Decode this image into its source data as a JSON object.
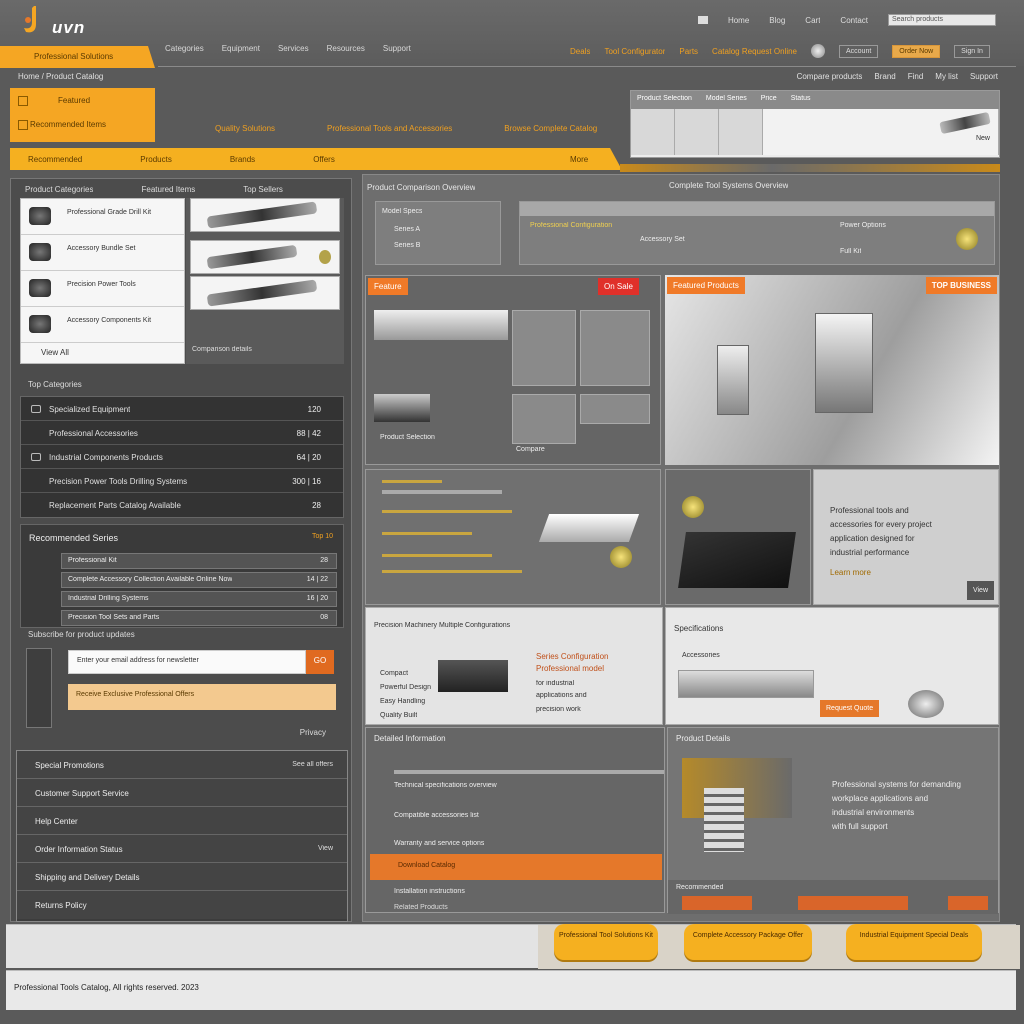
{
  "logo": {
    "word": "uvn"
  },
  "topnav": {
    "items": [
      "Home",
      "Blog",
      "Cart",
      "Contact"
    ],
    "search_placeholder": "Search products"
  },
  "brand_tab": {
    "label": "Professional Solutions"
  },
  "mainnav": {
    "items": [
      "Categories",
      "Equipment",
      "Services",
      "Resources",
      "Support"
    ]
  },
  "rightnav": {
    "items": [
      "Deals",
      "Tool Configurator",
      "Parts",
      "Catalog Request Online"
    ],
    "pill1": "Account",
    "pill2": "Order Now",
    "pill3": "Sign In"
  },
  "crumbs": {
    "left": "Home / Product Catalog",
    "right": [
      "Compare products",
      "Brand",
      "Find",
      "My list",
      "Support"
    ]
  },
  "hero": {
    "left_line1": "Featured",
    "left_line2": "Recommended Items",
    "mid": [
      "Quality Solutions",
      "Professional Tools and Accessories",
      "Browse Complete Catalog"
    ],
    "table_head": [
      "Product Selection",
      "Model Series",
      "Price",
      "Status"
    ],
    "table_tool_label": "New"
  },
  "orange_bar": {
    "items": [
      "Recommended",
      "Products",
      "Brands",
      "Offers"
    ],
    "right": "More"
  },
  "left": {
    "head": [
      "Product Categories",
      "Featured Items",
      "Top Sellers"
    ],
    "products": [
      {
        "name": "Professional Grade Drill Kit"
      },
      {
        "name": "Accessory Bundle Set"
      },
      {
        "name": "Precision Power Tools"
      },
      {
        "name": "Accessory Components Kit"
      }
    ],
    "products_foot": "View All",
    "img_label": "Comparison details",
    "list_title": "Top Categories",
    "menu1": [
      {
        "label": "Specialized Equipment",
        "val": "120"
      },
      {
        "label": "Professional Accessories",
        "val": "88 | 42"
      },
      {
        "label": "Industrial Components Products",
        "val": "64 | 20"
      },
      {
        "label": "Precision Power Tools Drilling Systems",
        "val": "300 | 16"
      },
      {
        "label": "Replacement Parts Catalog Available",
        "val": "28"
      }
    ],
    "menu2_head": "Recommended Series",
    "menu2_headr": "Top 10",
    "menu2_rows": [
      {
        "label": "Professional Kit",
        "val": "28"
      },
      {
        "label": "Complete Accessory Collection Available Online Now",
        "val": "14 | 22"
      },
      {
        "label": "Industrial Drilling Systems",
        "val": "16 | 20"
      },
      {
        "label": "Precision Tool Sets and Parts",
        "val": "08"
      }
    ],
    "menu2_foot": "Subscribe for product updates",
    "signup_input": "Enter your email address for newsletter",
    "signup_go": "GO",
    "signup_bar": "Receive Exclusive Professional Offers",
    "signup_foot": "Privacy",
    "acc": [
      {
        "label": "Special Promotions",
        "val": "See all offers"
      },
      {
        "label": "Customer Support Service",
        "val": ""
      },
      {
        "label": "Help Center",
        "val": ""
      },
      {
        "label": "Order Information Status",
        "val": "View"
      },
      {
        "label": "Shipping and Delivery Details",
        "val": ""
      },
      {
        "label": "Returns Policy",
        "val": ""
      }
    ]
  },
  "right": {
    "head_left": "Product Comparison Overview",
    "head_right": "Complete Tool Systems Overview",
    "p1_rows": [
      "Model Specs",
      "Series A",
      "Series B"
    ],
    "p2_rows": [
      "Professional Configuration",
      "Accessory Set",
      "Power Options",
      "Full Kit"
    ],
    "tab_feature": "Feature",
    "tab_sale": "On Sale",
    "tab_featured": "Featured Products",
    "tab_bestsellers": "TOP BUSINESS",
    "mid_caption": "Product Selection",
    "mid_caption_2": "Compare",
    "desc_panel": [
      "Professional tools and",
      "accessories for every project",
      "application designed for",
      "industrial performance",
      "Learn more"
    ],
    "desc_btn": "View",
    "row3_head_left": "Precision Machinery Multiple Configurations",
    "row3_left_text": [
      "Compact",
      "Powerful Design",
      "Easy Handling",
      "Quality Built"
    ],
    "row3_mid_text": [
      "Series Configuration",
      "Professional model",
      "for industrial",
      "applications and",
      "precision work"
    ],
    "row3_head_right": "Specifications",
    "row3_right_text": "Accessories",
    "row3_btn": "Request Quote",
    "row4_head_left": "Detailed Information",
    "row4_head_right": "Product Details",
    "row4_lines": [
      "Technical specifications overview",
      "Compatible accessories list",
      "Warranty and service options",
      "Installation instructions"
    ],
    "row4_orange": "Download Catalog",
    "row4_right_text": [
      "Professional systems for demanding",
      "workplace applications and",
      "industrial environments",
      "with full support"
    ],
    "row4_foot_left": "Related Products",
    "row4_foot_right": "Recommended"
  },
  "ctas": [
    "Professional Tool Solutions Kit",
    "Complete Accessory Package Offer",
    "Industrial Equipment Special Deals"
  ],
  "footer": {
    "text": "Professional Tools Catalog, All rights reserved. 2023"
  },
  "colors": {
    "accent": "#f5a623",
    "accent_dark": "#e5782a",
    "bg": "#5a5a5a"
  }
}
